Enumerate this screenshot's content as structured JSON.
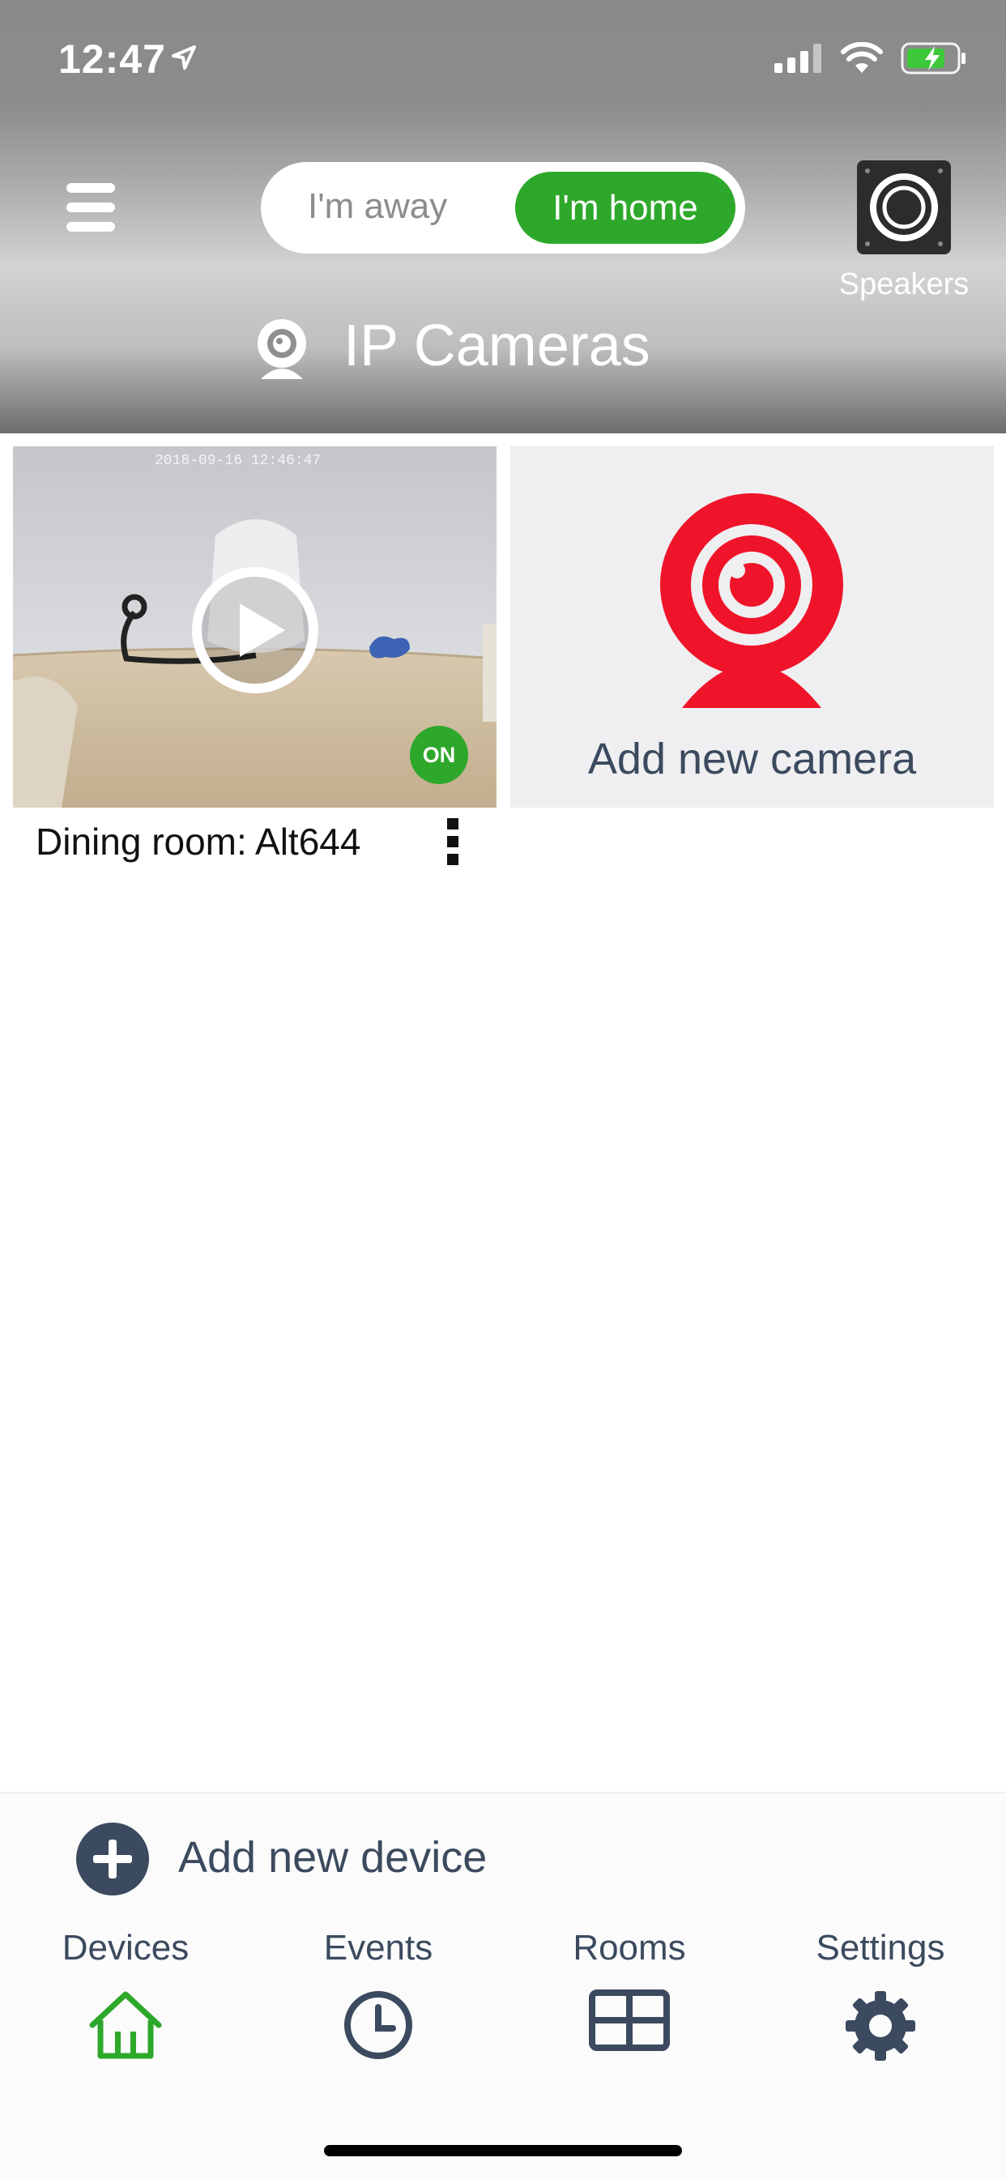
{
  "status_bar": {
    "time": "12:47"
  },
  "header": {
    "mode_toggle": {
      "away_label": "I'm away",
      "home_label": "I'm home",
      "selected": "home"
    },
    "speakers_label": "Speakers",
    "section_title": "IP Cameras"
  },
  "cameras": [
    {
      "name": "Dining room: Alt644",
      "timestamp": "2018-09-16 12:46:47",
      "status": "ON"
    }
  ],
  "add_camera_label": "Add new camera",
  "add_device_label": "Add new device",
  "tabs": [
    {
      "label": "Devices",
      "icon": "house-icon",
      "active": true
    },
    {
      "label": "Events",
      "icon": "clock-icon",
      "active": false
    },
    {
      "label": "Rooms",
      "icon": "grid-icon",
      "active": false
    },
    {
      "label": "Settings",
      "icon": "gear-icon",
      "active": false
    }
  ],
  "colors": {
    "accent_green": "#2ea82a",
    "camera_red": "#f0142a",
    "text_dark": "#3b4a5e"
  }
}
